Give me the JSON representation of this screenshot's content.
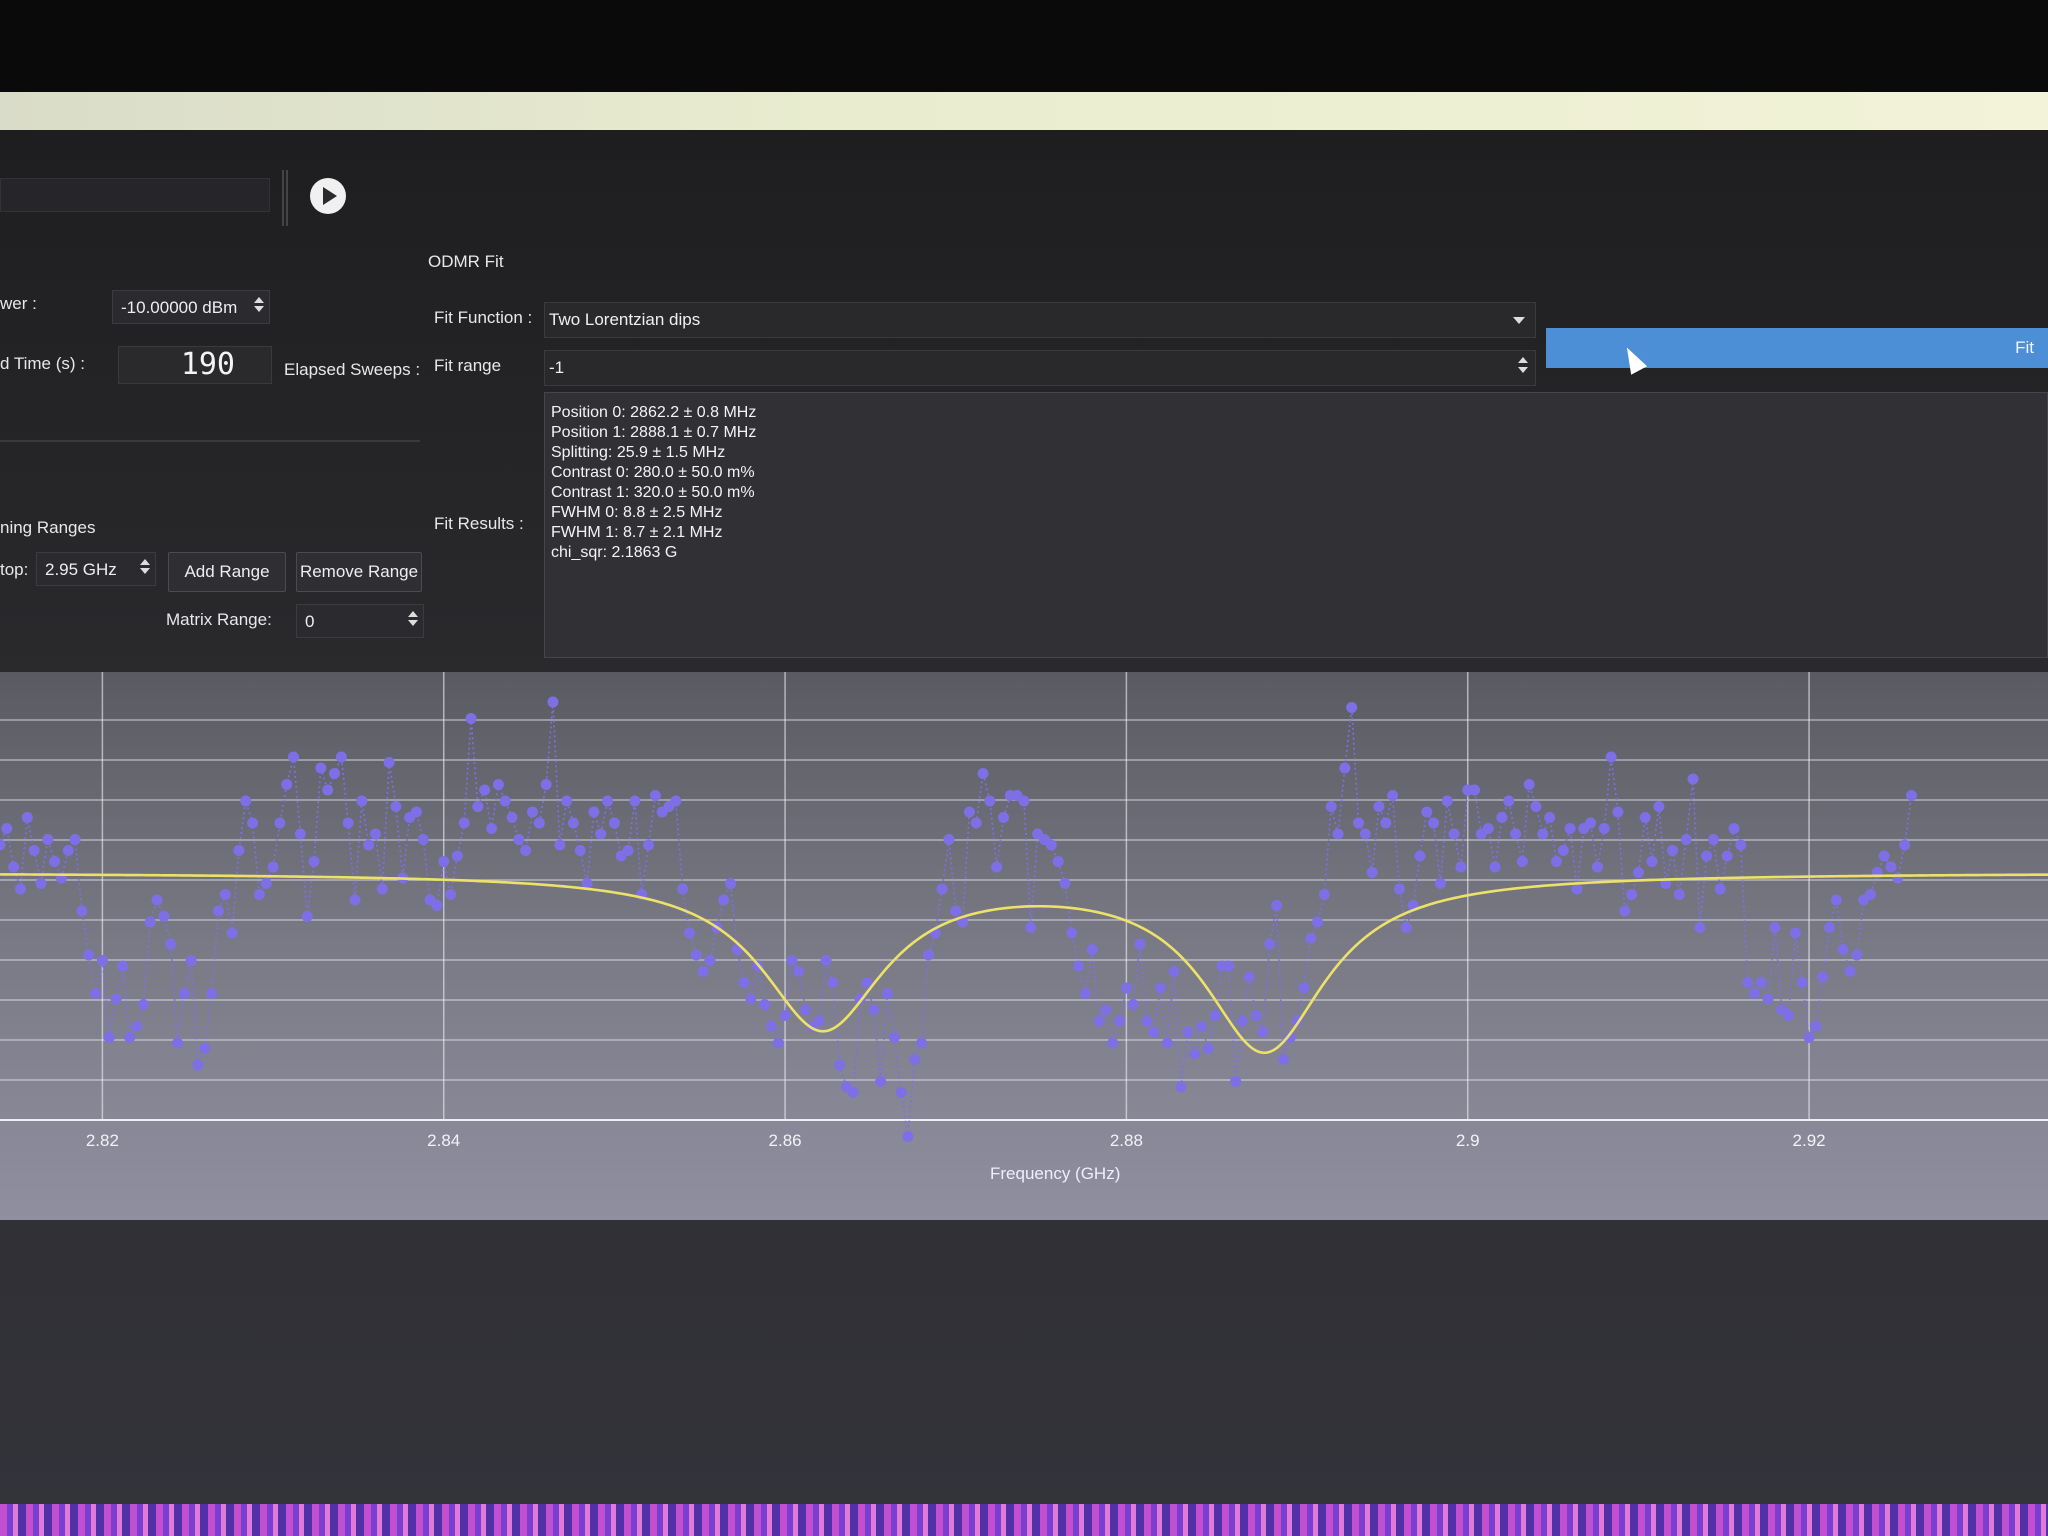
{
  "toolbar": {
    "play_icon": "play-icon"
  },
  "left_panel": {
    "power_label": "wer :",
    "power_value": "-10.00000 dBm",
    "time_label": "d Time (s) :",
    "time_value": "190",
    "elapsed_label": "Elapsed Sweeps :",
    "ranges_label": "ning Ranges",
    "stop_label": "top:",
    "stop_value": "2.95 GHz",
    "add_range": "Add Range",
    "remove_range": "Remove Range",
    "matrix_label": "Matrix Range:",
    "matrix_value": "0"
  },
  "fit_panel": {
    "title": "ODMR Fit",
    "fit_function_label": "Fit Function :",
    "fit_function_value": "Two Lorentzian dips",
    "fit_range_label": "Fit range",
    "fit_range_value": "-1",
    "fit_button": "Fit",
    "fit_results_label": "Fit Results   :",
    "results": [
      "Position 0: 2862.2 ± 0.8 MHz",
      "Position 1: 2888.1 ± 0.7 MHz",
      "Splitting: 25.9 ± 1.5 MHz",
      "Contrast 0: 280.0 ± 50.0 m%",
      "Contrast 1: 320.0 ± 50.0 m%",
      "FWHM 0: 8.8 ± 2.5 MHz",
      "FWHM 1: 8.7 ± 2.1 MHz",
      "chi_sqr: 2.1863 G"
    ]
  },
  "chart_data": {
    "type": "scatter",
    "xlabel": "Frequency (GHz)",
    "ticks": [
      2.82,
      2.84,
      2.86,
      2.88,
      2.9,
      2.92
    ],
    "tick_labels": [
      "2.82",
      "2.84",
      "2.86",
      "2.88",
      "2.9",
      "2.92"
    ],
    "xlim": [
      2.814,
      2.934
    ],
    "ylim": [
      0.955,
      1.035
    ],
    "fit": {
      "baseline": 1.0,
      "center0": 2.8622,
      "fwhm0": 0.0088,
      "depth0": 0.028,
      "center1": 2.8881,
      "fwhm1": 0.0087,
      "depth1": 0.032
    },
    "series": [
      {
        "x_start": 2.814,
        "x_step": 0.0004,
        "values": [
          1.005,
          1.008,
          1.001,
          0.997,
          1.01,
          1.004,
          0.998,
          1.006,
          1.002,
          0.999,
          1.004,
          1.006,
          0.993,
          0.985,
          0.978,
          0.984,
          0.97,
          0.977,
          0.983,
          0.97,
          0.972,
          0.976,
          0.991,
          0.995,
          0.992,
          0.987,
          0.969,
          0.978,
          0.984,
          0.965,
          0.968,
          0.978,
          0.993,
          0.996,
          0.989,
          1.004,
          1.013,
          1.009,
          0.996,
          0.998,
          1.001,
          1.009,
          1.016,
          1.021,
          1.007,
          0.992,
          1.002,
          1.019,
          1.015,
          1.018,
          1.021,
          1.009,
          0.995,
          1.013,
          1.005,
          1.007,
          0.997,
          1.02,
          1.012,
          0.999,
          1.01,
          1.011,
          1.006,
          0.995,
          0.994,
          1.002,
          0.996,
          1.003,
          1.009,
          1.028,
          1.012,
          1.015,
          1.008,
          1.016,
          1.013,
          1.01,
          1.006,
          1.004,
          1.011,
          1.009,
          1.016,
          1.031,
          1.005,
          1.013,
          1.009,
          1.004,
          0.998,
          1.011,
          1.007,
          1.013,
          1.009,
          1.003,
          1.004,
          1.013,
          0.996,
          1.005,
          1.014,
          1.011,
          1.012,
          1.013,
          0.997,
          0.989,
          0.985,
          0.982,
          0.984,
          0.99,
          0.995,
          0.998,
          0.986,
          0.98,
          0.977,
          0.983,
          0.976,
          0.972,
          0.969,
          0.974,
          0.984,
          0.982,
          0.975,
          0.972,
          0.973,
          0.984,
          0.98,
          0.965,
          0.961,
          0.96,
          0.977,
          0.98,
          0.975,
          0.962,
          0.978,
          0.97,
          0.96,
          0.952,
          0.966,
          0.969,
          0.985,
          0.989,
          0.997,
          1.006,
          0.993,
          0.991,
          1.011,
          1.009,
          1.018,
          1.013,
          1.001,
          1.01,
          1.014,
          1.014,
          1.013,
          0.99,
          1.007,
          1.006,
          1.005,
          1.002,
          0.998,
          0.989,
          0.983,
          0.978,
          0.986,
          0.973,
          0.975,
          0.969,
          0.973,
          0.979,
          0.976,
          0.987,
          0.973,
          0.971,
          0.979,
          0.969,
          0.982,
          0.961,
          0.971,
          0.967,
          0.972,
          0.968,
          0.974,
          0.983,
          0.983,
          0.962,
          0.973,
          0.981,
          0.974,
          0.971,
          0.987,
          0.994,
          0.966,
          0.97,
          0.973,
          0.979,
          0.988,
          0.991,
          0.996,
          1.012,
          1.007,
          1.019,
          1.03,
          1.009,
          1.007,
          1.0,
          1.012,
          1.009,
          1.014,
          0.997,
          0.99,
          0.994,
          1.003,
          1.011,
          1.009,
          0.998,
          1.013,
          1.007,
          1.001,
          1.015,
          1.015,
          1.007,
          1.008,
          1.001,
          1.01,
          1.013,
          1.007,
          1.002,
          1.016,
          1.012,
          1.007,
          1.01,
          1.002,
          1.004,
          1.008,
          0.997,
          1.008,
          1.009,
          1.001,
          1.008,
          1.021,
          1.011,
          0.993,
          0.996,
          1.0,
          1.01,
          1.002,
          1.012,
          0.998,
          1.004,
          0.996,
          1.006,
          1.017,
          0.99,
          1.003,
          1.006,
          0.997,
          1.003,
          1.008,
          1.005,
          0.98,
          0.978,
          0.98,
          0.977,
          0.99,
          0.975,
          0.974,
          0.989,
          0.98,
          0.97,
          0.972,
          0.981,
          0.99,
          0.995,
          0.986,
          0.982,
          0.985,
          0.995,
          0.996,
          1.0,
          1.003,
          1.001,
          0.999,
          1.005,
          1.014
        ]
      }
    ]
  },
  "colors": {
    "points": "#7f6fe6",
    "fit": "#ece26a",
    "fit_button": "#4d8fd6"
  }
}
